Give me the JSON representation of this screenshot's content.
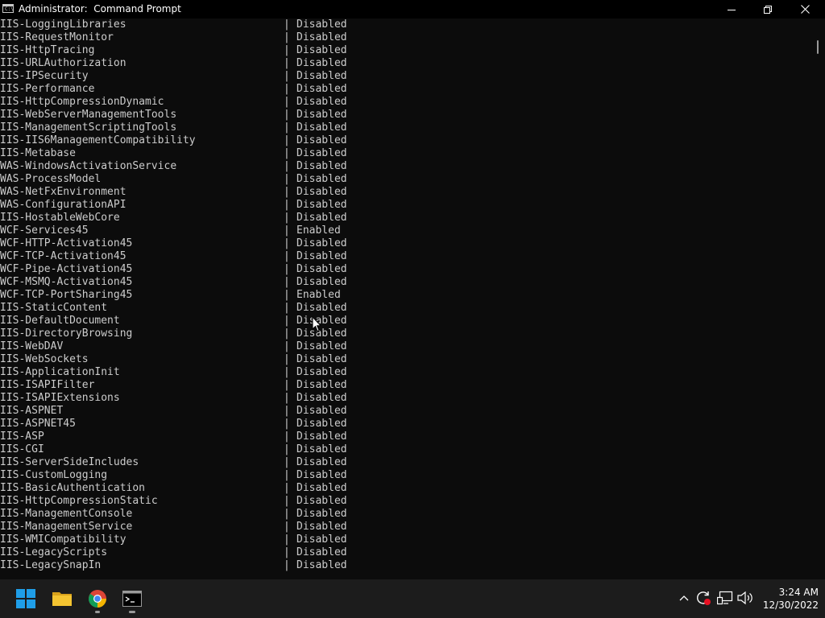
{
  "window": {
    "title": "Administrator:  Command Prompt",
    "icon_text": "C:\\",
    "controls": [
      "minimize-icon",
      "restore-icon",
      "close-icon"
    ]
  },
  "console": {
    "separator": "|",
    "rows": [
      {
        "name": "IIS-LoggingLibraries",
        "state": "Disabled"
      },
      {
        "name": "IIS-RequestMonitor",
        "state": "Disabled"
      },
      {
        "name": "IIS-HttpTracing",
        "state": "Disabled"
      },
      {
        "name": "IIS-URLAuthorization",
        "state": "Disabled"
      },
      {
        "name": "IIS-IPSecurity",
        "state": "Disabled"
      },
      {
        "name": "IIS-Performance",
        "state": "Disabled"
      },
      {
        "name": "IIS-HttpCompressionDynamic",
        "state": "Disabled"
      },
      {
        "name": "IIS-WebServerManagementTools",
        "state": "Disabled"
      },
      {
        "name": "IIS-ManagementScriptingTools",
        "state": "Disabled"
      },
      {
        "name": "IIS-IIS6ManagementCompatibility",
        "state": "Disabled"
      },
      {
        "name": "IIS-Metabase",
        "state": "Disabled"
      },
      {
        "name": "WAS-WindowsActivationService",
        "state": "Disabled"
      },
      {
        "name": "WAS-ProcessModel",
        "state": "Disabled"
      },
      {
        "name": "WAS-NetFxEnvironment",
        "state": "Disabled"
      },
      {
        "name": "WAS-ConfigurationAPI",
        "state": "Disabled"
      },
      {
        "name": "IIS-HostableWebCore",
        "state": "Disabled"
      },
      {
        "name": "WCF-Services45",
        "state": "Enabled"
      },
      {
        "name": "WCF-HTTP-Activation45",
        "state": "Disabled"
      },
      {
        "name": "WCF-TCP-Activation45",
        "state": "Disabled"
      },
      {
        "name": "WCF-Pipe-Activation45",
        "state": "Disabled"
      },
      {
        "name": "WCF-MSMQ-Activation45",
        "state": "Disabled"
      },
      {
        "name": "WCF-TCP-PortSharing45",
        "state": "Enabled"
      },
      {
        "name": "IIS-StaticContent",
        "state": "Disabled"
      },
      {
        "name": "IIS-DefaultDocument",
        "state": "Disabled"
      },
      {
        "name": "IIS-DirectoryBrowsing",
        "state": "Disabled"
      },
      {
        "name": "IIS-WebDAV",
        "state": "Disabled"
      },
      {
        "name": "IIS-WebSockets",
        "state": "Disabled"
      },
      {
        "name": "IIS-ApplicationInit",
        "state": "Disabled"
      },
      {
        "name": "IIS-ISAPIFilter",
        "state": "Disabled"
      },
      {
        "name": "IIS-ISAPIExtensions",
        "state": "Disabled"
      },
      {
        "name": "IIS-ASPNET",
        "state": "Disabled"
      },
      {
        "name": "IIS-ASPNET45",
        "state": "Disabled"
      },
      {
        "name": "IIS-ASP",
        "state": "Disabled"
      },
      {
        "name": "IIS-CGI",
        "state": "Disabled"
      },
      {
        "name": "IIS-ServerSideIncludes",
        "state": "Disabled"
      },
      {
        "name": "IIS-CustomLogging",
        "state": "Disabled"
      },
      {
        "name": "IIS-BasicAuthentication",
        "state": "Disabled"
      },
      {
        "name": "IIS-HttpCompressionStatic",
        "state": "Disabled"
      },
      {
        "name": "IIS-ManagementConsole",
        "state": "Disabled"
      },
      {
        "name": "IIS-ManagementService",
        "state": "Disabled"
      },
      {
        "name": "IIS-WMICompatibility",
        "state": "Disabled"
      },
      {
        "name": "IIS-LegacyScripts",
        "state": "Disabled"
      },
      {
        "name": "IIS-LegacySnapIn",
        "state": "Disabled"
      }
    ]
  },
  "taskbar": {
    "apps": [
      "start-icon",
      "file-explorer-icon",
      "chrome-icon",
      "command-prompt-icon"
    ],
    "tray_icons": [
      "chevron-up-icon",
      "update-icon",
      "network-icon",
      "volume-icon"
    ],
    "time": "3:24 AM",
    "date": "12/30/2022"
  },
  "colors": {
    "console_bg": "#0c0c0c",
    "console_fg": "#cccccc",
    "taskbar_bg": "#1c1c1c",
    "windows_blue": "#1f9ee8",
    "explorer_yellow": "#f4c431"
  }
}
